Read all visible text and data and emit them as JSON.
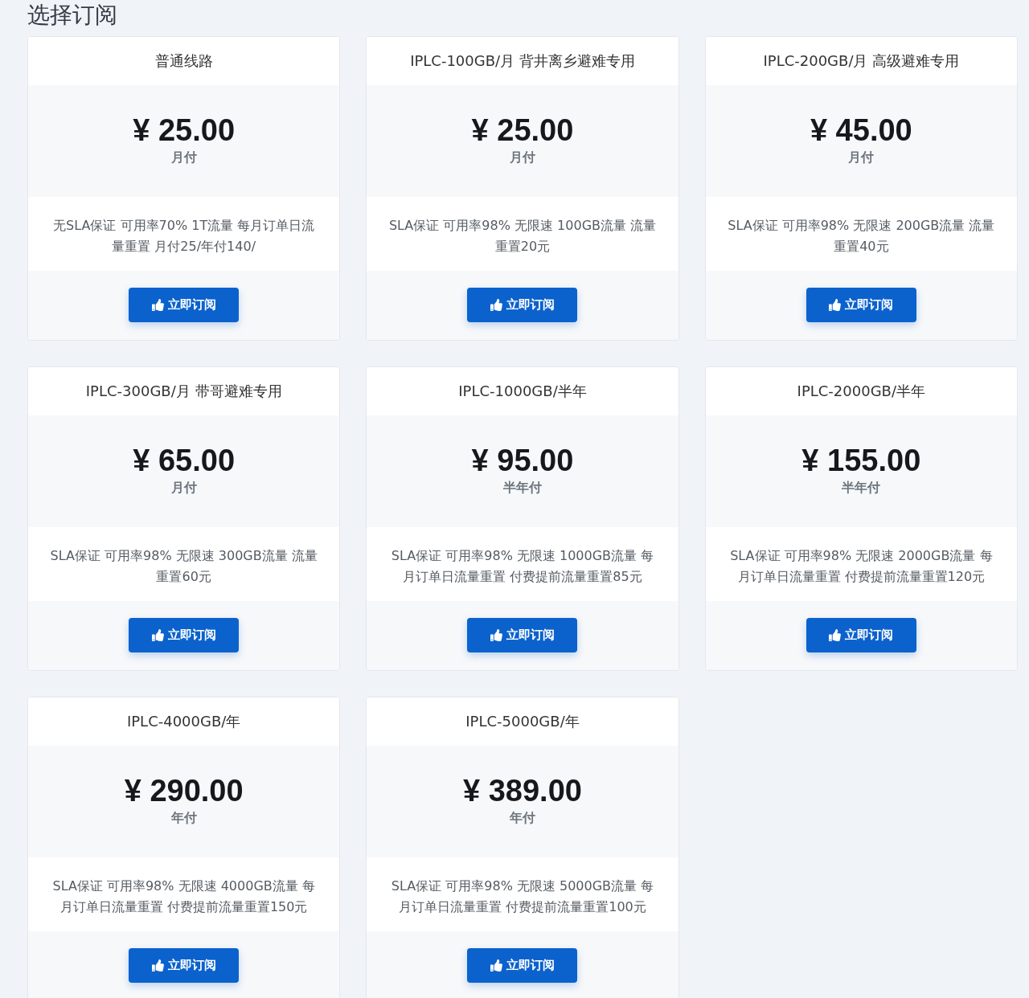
{
  "page": {
    "title": "选择订阅"
  },
  "plans": [
    {
      "name": "普通线路",
      "price": "¥ 25.00",
      "period": "月付",
      "description": "无SLA保证 可用率70% 1T流量 每月订单日流量重置 月付25/年付140/",
      "button": "立即订阅"
    },
    {
      "name": "IPLC-100GB/月 背井离乡避难专用",
      "price": "¥ 25.00",
      "period": "月付",
      "description": "SLA保证 可用率98% 无限速 100GB流量 流量重置20元",
      "button": "立即订阅"
    },
    {
      "name": "IPLC-200GB/月 高级避难专用",
      "price": "¥ 45.00",
      "period": "月付",
      "description": "SLA保证 可用率98% 无限速 200GB流量 流量重置40元",
      "button": "立即订阅"
    },
    {
      "name": "IPLC-300GB/月 带哥避难专用",
      "price": "¥ 65.00",
      "period": "月付",
      "description": "SLA保证 可用率98% 无限速 300GB流量 流量重置60元",
      "button": "立即订阅"
    },
    {
      "name": "IPLC-1000GB/半年",
      "price": "¥ 95.00",
      "period": "半年付",
      "description": "SLA保证 可用率98% 无限速 1000GB流量 每月订单日流量重置 付费提前流量重置85元",
      "button": "立即订阅"
    },
    {
      "name": "IPLC-2000GB/半年",
      "price": "¥ 155.00",
      "period": "半年付",
      "description": "SLA保证 可用率98% 无限速 2000GB流量 每月订单日流量重置 付费提前流量重置120元",
      "button": "立即订阅"
    },
    {
      "name": "IPLC-4000GB/年",
      "price": "¥ 290.00",
      "period": "年付",
      "description": "SLA保证 可用率98% 无限速 4000GB流量 每月订单日流量重置 付费提前流量重置150元",
      "button": "立即订阅"
    },
    {
      "name": "IPLC-5000GB/年",
      "price": "¥ 389.00",
      "period": "年付",
      "description": "SLA保证 可用率98% 无限速 5000GB流量 每月订单日流量重置 付费提前流量重置100元",
      "button": "立即订阅"
    }
  ]
}
